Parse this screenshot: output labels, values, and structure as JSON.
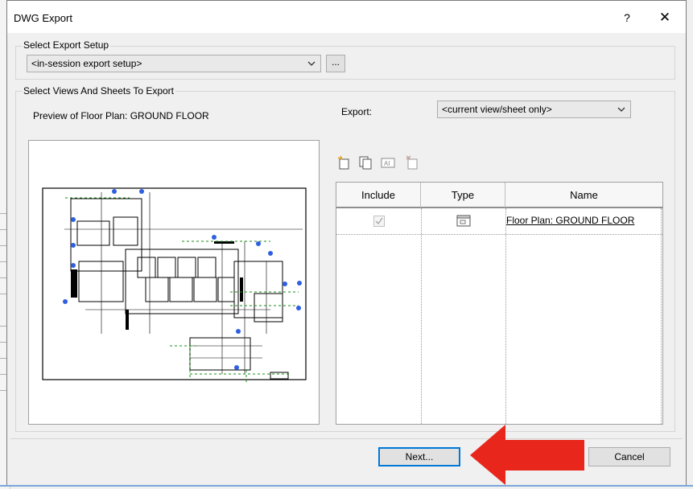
{
  "window": {
    "title": "DWG Export",
    "help_label": "?",
    "close_label": "✕"
  },
  "export_setup": {
    "group_label": "Select Export Setup",
    "selected": "<in-session export setup>",
    "more_button": "..."
  },
  "views": {
    "group_label": "Select Views And Sheets To Export",
    "preview_label": "Preview of Floor Plan: GROUND FLOOR",
    "export_label": "Export:",
    "export_selected": "<current view/sheet only>",
    "toolbar_icons": [
      "new-set-icon",
      "duplicate-set-icon",
      "rename-set-icon",
      "delete-set-icon"
    ],
    "columns": [
      "Include",
      "Type",
      "Name"
    ],
    "rows": [
      {
        "include": true,
        "type_icon": "floor-plan-view-icon",
        "name": "Floor Plan: GROUND FLOOR"
      }
    ]
  },
  "footer": {
    "next_label": "Next...",
    "cancel_label": "Cancel"
  },
  "colors": {
    "accent": "#0078d7",
    "annotation_arrow": "#e8261c"
  }
}
